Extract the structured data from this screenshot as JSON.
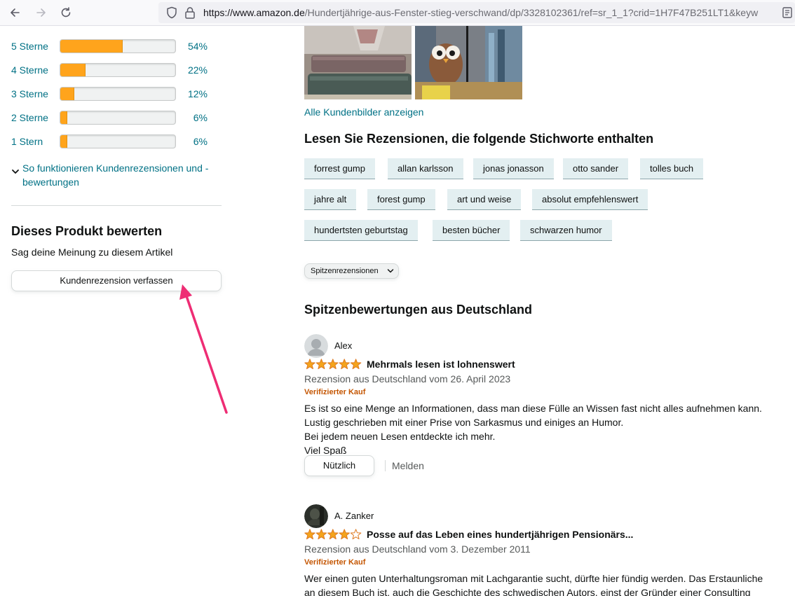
{
  "browser": {
    "url_host": "https://www.amazon.de",
    "url_path": "/Hundertjährige-aus-Fenster-stieg-verschwand/dp/3328102361/ref=sr_1_1?crid=1H7F47B251LT1&keyw",
    "icons": [
      "back-arrow-icon",
      "forward-arrow-icon",
      "reload-icon",
      "shield-icon",
      "lock-icon",
      "reader-view-icon"
    ]
  },
  "histogram": {
    "rows": [
      {
        "label": "5 Sterne",
        "percent_text": "54%",
        "fraction": 0.54
      },
      {
        "label": "4 Sterne",
        "percent_text": "22%",
        "fraction": 0.22
      },
      {
        "label": "3 Sterne",
        "percent_text": "12%",
        "fraction": 0.12
      },
      {
        "label": "2 Sterne",
        "percent_text": "6%",
        "fraction": 0.06
      },
      {
        "label": "1 Stern",
        "percent_text": "6%",
        "fraction": 0.06
      }
    ],
    "bar_color": "#ffa41c"
  },
  "howto_link": "So funktionieren Kundenrezensionen und -bewertungen",
  "rate_section": {
    "title": "Dieses Produkt bewerten",
    "subtitle": "Sag deine Meinung zu diesem Artikel",
    "button_label": "Kundenrezension verfassen"
  },
  "annotation_color": "#ee2d74",
  "customer_images": {
    "link": "Alle Kundenbilder anzeigen"
  },
  "keywords": {
    "title": "Lesen Sie Rezensionen, die folgende Stichworte enthalten",
    "chips": [
      "forrest gump",
      "allan karlsson",
      "jonas jonasson",
      "otto sander",
      "tolles buch",
      "jahre alt",
      "forest gump",
      "art und weise",
      "absolut empfehlenswert",
      "hundertsten geburtstag",
      "besten bücher",
      "schwarzen humor"
    ]
  },
  "sort": {
    "selected": "Spitzenrezensionen"
  },
  "top_reviews_title": "Spitzenbewertungen aus Deutschland",
  "reviews": [
    {
      "author": "Alex",
      "rating": 5,
      "title": "Mehrmals lesen ist lohnenswert",
      "date": "Rezension aus Deutschland vom 26. April 2023",
      "verified": "Verifizierter Kauf",
      "body": [
        "Es ist so eine Menge an Informationen, dass man diese Fülle an Wissen fast nicht alles aufnehmen kann.",
        "Lustig geschrieben mit einer Prise von Sarkasmus und einiges an Humor.",
        "Bei jedem neuen Lesen entdeckte ich mehr.",
        "Viel Spaß"
      ],
      "helpful_label": "Nützlich",
      "report_label": "Melden"
    },
    {
      "author": "A. Zanker",
      "rating": 4,
      "title": "Posse auf das Leben eines hundertjährigen Pensionärs...",
      "date": "Rezension aus Deutschland vom 3. Dezember 2011",
      "verified": "Verifizierter Kauf",
      "body": [
        "Wer einen guten Unterhaltungsroman mit Lachgarantie sucht, dürfte hier fündig werden. Das Erstaunliche",
        "an diesem Buch ist, auch die Geschichte des schwedischen Autors, einst der Gründer einer Consulting"
      ]
    }
  ],
  "star_color": "#f4a41c"
}
